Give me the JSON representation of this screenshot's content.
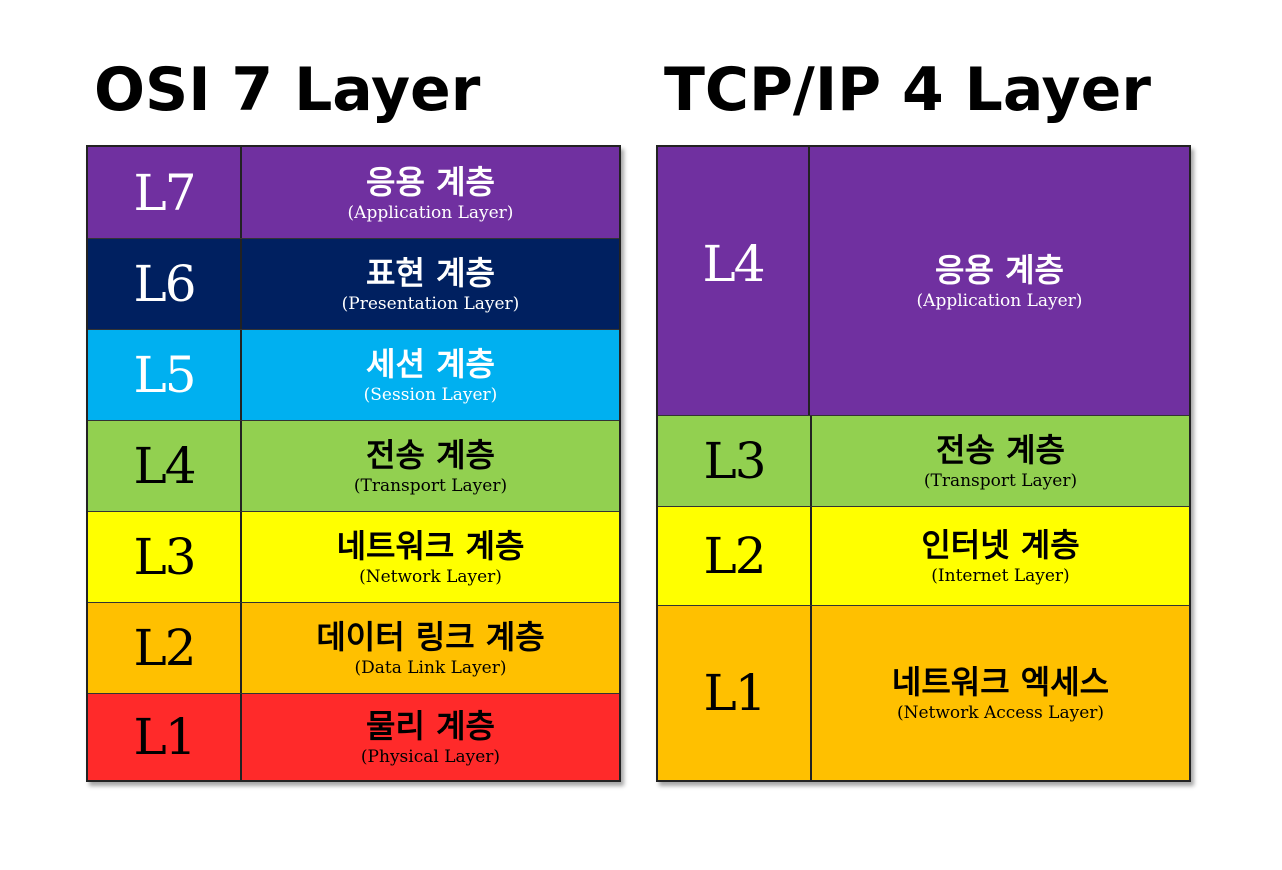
{
  "osi": {
    "title": "OSI 7 Layer",
    "layers": [
      {
        "num": "L7",
        "ko": "응용 계층",
        "en": "(Application Layer)",
        "color": "#7030a0"
      },
      {
        "num": "L6",
        "ko": "표현 계층",
        "en": "(Presentation Layer)",
        "color": "#002060"
      },
      {
        "num": "L5",
        "ko": "세션 계층",
        "en": "(Session Layer)",
        "color": "#00b0f0"
      },
      {
        "num": "L4",
        "ko": "전송 계층",
        "en": "(Transport Layer)",
        "color": "#92d050"
      },
      {
        "num": "L3",
        "ko": "네트워크 계층",
        "en": "(Network Layer)",
        "color": "#ffff00"
      },
      {
        "num": "L2",
        "ko": "데이터 링크 계층",
        "en": "(Data Link Layer)",
        "color": "#ffc000"
      },
      {
        "num": "L1",
        "ko": "물리 계층",
        "en": "(Physical Layer)",
        "color": "#ff2a2a"
      }
    ]
  },
  "tcp": {
    "title": "TCP/IP 4 Layer",
    "layers": [
      {
        "num": "L4",
        "ko": "응용 계층",
        "en": "(Application Layer)",
        "color": "#7030a0"
      },
      {
        "num": "L3",
        "ko": "전송 계층",
        "en": "(Transport Layer)",
        "color": "#92d050"
      },
      {
        "num": "L2",
        "ko": "인터넷 계층",
        "en": "(Internet Layer)",
        "color": "#ffff00"
      },
      {
        "num": "L1",
        "ko": "네트워크 엑세스",
        "en": "(Network Access Layer)",
        "color": "#ffc000"
      }
    ]
  }
}
